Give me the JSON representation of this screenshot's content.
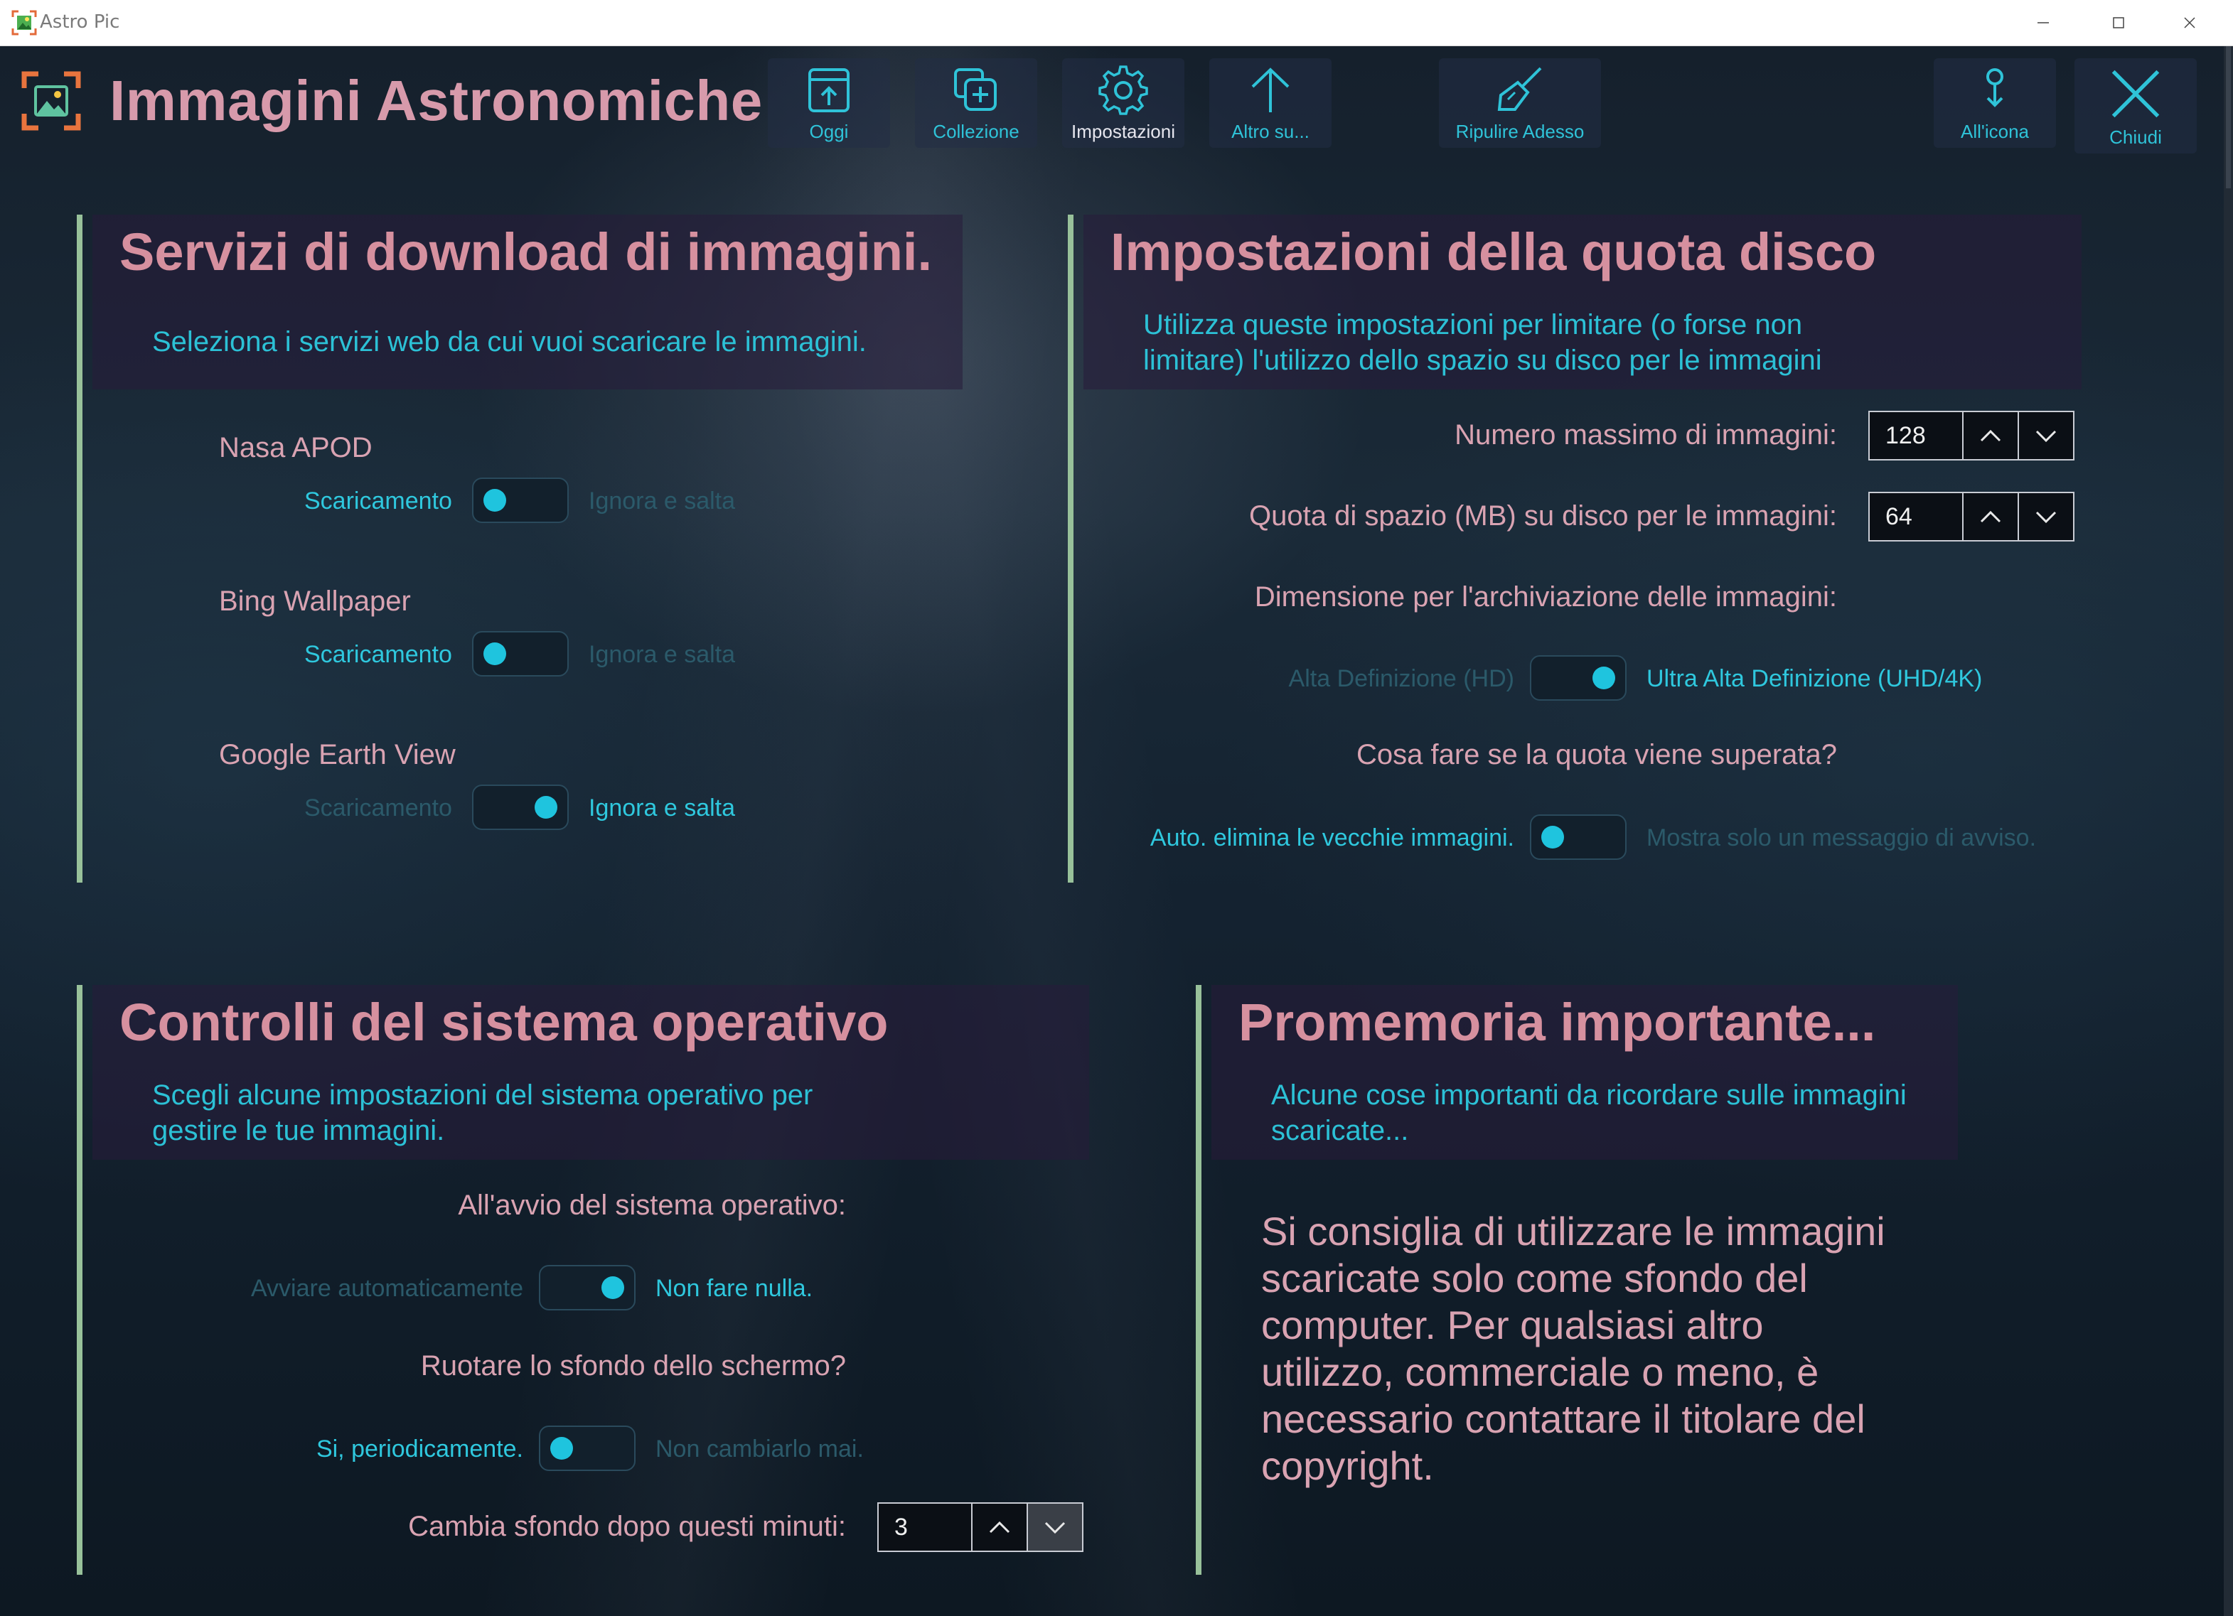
{
  "window": {
    "title": "Astro Pic",
    "controls": [
      "minimize",
      "maximize",
      "close"
    ]
  },
  "header": {
    "title": "Immagini Astronomiche",
    "commands": [
      {
        "id": "oggi",
        "label": "Oggi",
        "icon": "today-icon"
      },
      {
        "id": "collezione",
        "label": "Collezione",
        "icon": "collection-add-icon"
      },
      {
        "id": "impostazioni",
        "label": "Impostazioni",
        "icon": "gear-icon",
        "active": true
      },
      {
        "id": "altro",
        "label": "Altro su...",
        "icon": "arrow-up-icon"
      },
      {
        "id": "ripulire",
        "label": "Ripulire Adesso",
        "icon": "broom-icon"
      },
      {
        "id": "icona",
        "label": "All'icona",
        "icon": "pin-icon"
      },
      {
        "id": "chiudi",
        "label": "Chiudi",
        "icon": "close-icon"
      }
    ]
  },
  "download_services": {
    "title": "Servizi di download di immagini.",
    "subtitle": "Seleziona i servizi web da cui vuoi scaricare le immagini.",
    "services": [
      {
        "name": "Nasa APOD",
        "on_label": "Scaricamento",
        "off_label": "Ignora e salta",
        "state": "Scaricamento"
      },
      {
        "name": "Bing Wallpaper",
        "on_label": "Scaricamento",
        "off_label": "Ignora e salta",
        "state": "Scaricamento"
      },
      {
        "name": "Google Earth View",
        "on_label": "Scaricamento",
        "off_label": "Ignora e salta",
        "state": "Ignora e salta"
      }
    ]
  },
  "disk_quota": {
    "title": "Impostazioni della quota disco",
    "subtitle_line1": "Utilizza queste impostazioni per limitare (o forse non",
    "subtitle_line2": "limitare) l'utilizzo dello spazio su disco per le immagini",
    "max_images_label": "Numero massimo di immagini:",
    "max_images_value": "128",
    "quota_label": "Quota di spazio (MB) su disco per le immagini:",
    "quota_value": "64",
    "size_label": "Dimensione per l'archiviazione delle immagini:",
    "size_left": "Alta Definizione (HD)",
    "size_right": "Ultra Alta Definizione (UHD/4K)",
    "size_state": "Ultra Alta Definizione (UHD/4K)",
    "exceeded_label": "Cosa fare se la quota viene superata?",
    "exceeded_left": "Auto. elimina le vecchie immagini.",
    "exceeded_right": "Mostra solo un messaggio di avviso.",
    "exceeded_state": "Auto. elimina le vecchie immagini."
  },
  "os_controls": {
    "title": "Controlli del sistema operativo",
    "subtitle_line1": "Scegli alcune impostazioni del sistema operativo per",
    "subtitle_line2": "gestire le tue immagini.",
    "startup_label": "All'avvio del sistema operativo:",
    "startup_left": "Avviare automaticamente",
    "startup_right": "Non fare nulla.",
    "startup_state": "Non fare nulla.",
    "rotate_label": "Ruotare lo sfondo dello schermo?",
    "rotate_left": "Si, periodicamente.",
    "rotate_right": "Non cambiarlo mai.",
    "rotate_state": "Si, periodicamente.",
    "minutes_label": "Cambia sfondo dopo questi minuti:",
    "minutes_value": "3"
  },
  "reminder": {
    "title": "Promemoria importante...",
    "subtitle_line1": "Alcune cose importanti da ricordare sulle immagini",
    "subtitle_line2": "scaricate...",
    "body": [
      "Si consiglia di utilizzare le immagini",
      "scaricate solo come sfondo del",
      "computer. Per qualsiasi altro",
      "utilizzo, commerciale o meno, è",
      "necessario contattare il titolare del",
      "copyright."
    ]
  },
  "colors": {
    "accent_cyan": "#2fc3d8",
    "title_pink": "#d6909f",
    "label_pink": "#d9a3b2",
    "bar_green": "#98c19a"
  }
}
